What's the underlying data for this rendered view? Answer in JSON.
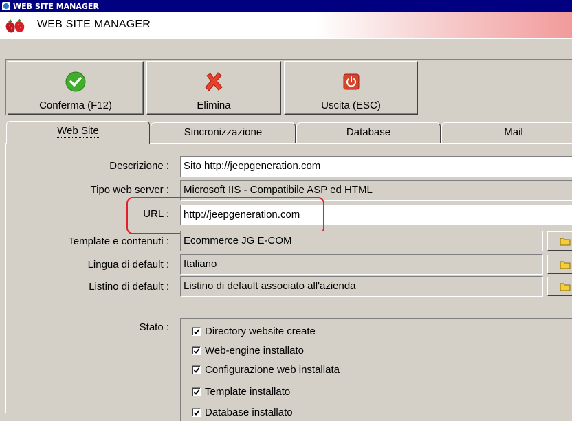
{
  "window": {
    "title": "WEB SITE MANAGER"
  },
  "header": {
    "title": "WEB SITE MANAGER",
    "logo": "strawberry-logo"
  },
  "toolbar": {
    "confirm_label": "Conferma (F12)",
    "delete_label": "Elimina",
    "exit_label": "Uscita (ESC)"
  },
  "tabs": [
    {
      "label": "Web Site",
      "active": true
    },
    {
      "label": "Sincronizzazione",
      "active": false
    },
    {
      "label": "Database",
      "active": false
    },
    {
      "label": "Mail",
      "active": false
    }
  ],
  "form": {
    "descrizione": {
      "label": "Descrizione :",
      "value": "Sito http://jeepgeneration.com"
    },
    "tipo_web_server": {
      "label": "Tipo web server :",
      "value": "Microsoft IIS - Compatibile ASP ed HTML"
    },
    "url": {
      "label": "URL :",
      "value": "http://jeepgeneration.com"
    },
    "template": {
      "label": "Template e contenuti :",
      "value": "Ecommerce JG E-COM"
    },
    "lingua": {
      "label": "Lingua di default :",
      "value": "Italiano"
    },
    "listino": {
      "label": "Listino di default :",
      "value": "Listino di default associato all'azienda"
    }
  },
  "stato": {
    "label": "Stato :",
    "items": [
      {
        "label": "Directory website create",
        "checked": true
      },
      {
        "label": "Web-engine installato",
        "checked": true
      },
      {
        "label": "Configurazione web installata",
        "checked": true
      },
      {
        "label": "Template installato",
        "checked": true
      },
      {
        "label": "Database installato",
        "checked": true
      }
    ]
  },
  "colors": {
    "titlebar": "#000080",
    "highlight": "#e0202a",
    "window": "#d4d0c8"
  }
}
